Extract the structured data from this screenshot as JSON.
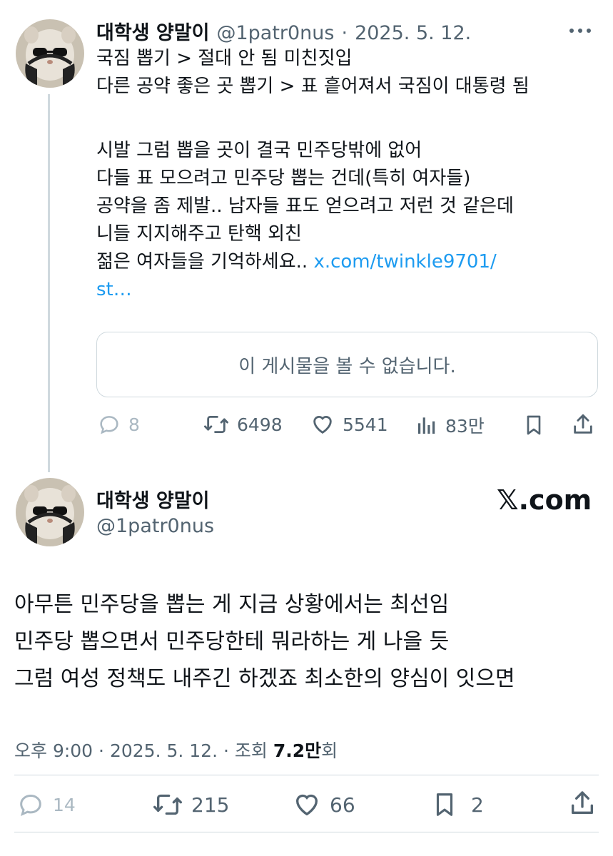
{
  "tweet1": {
    "name": "대학생 양말이",
    "handle": "@1patr0nus",
    "date": "2025. 5. 12.",
    "more_icon": "more-horizontal-icon",
    "lines": [
      "국짐 뽑기 > 절대 안 됨 미친짓입",
      "다른 공약 좋은 곳 뽑기 > 표 흩어져서 국짐이 대통령 됨",
      "",
      "시발 그럼 뽑을 곳이 결국 민주당밖에 없어",
      "다들 표 모으려고 민주당 뽑는 건데(특히 여자들)",
      "공약을 좀 제발.. 남자들 표도 얻으려고 저런 것 같은데",
      "니들 지지해주고 탄핵 외친"
    ],
    "last_line_text": "젊은 여자들을 기억하세요..",
    "link_part1": "x.com/twinkle9701/",
    "link_part2": "st…",
    "quote_unavailable": "이 게시물을 볼 수 없습니다.",
    "actions": {
      "replies": "8",
      "retweets": "6498",
      "likes": "5541",
      "views": "83만"
    }
  },
  "tweet2": {
    "name": "대학생 양말이",
    "handle": "@1patr0nus",
    "brand": "𝕏.com",
    "lines": [
      "아무튼 민주당을 뽑는 게 지금 상황에서는 최선임",
      "민주당 뽑으면서 민주당한테 뭐라하는 게 나을 듯",
      "그럼 여성 정책도 내주긴 하겠죠 최소한의 양심이 잇으면"
    ],
    "time": "오후 9:00",
    "date": "2025. 5. 12.",
    "views_label": "조회",
    "views_value": "7.2만",
    "views_suffix": "회",
    "actions": {
      "replies": "14",
      "retweets": "215",
      "likes": "66",
      "bookmarks": "2"
    }
  },
  "colors": {
    "text": "#0f1419",
    "secondary": "#536471",
    "link": "#1d9bf0",
    "border": "#cfd9de"
  }
}
